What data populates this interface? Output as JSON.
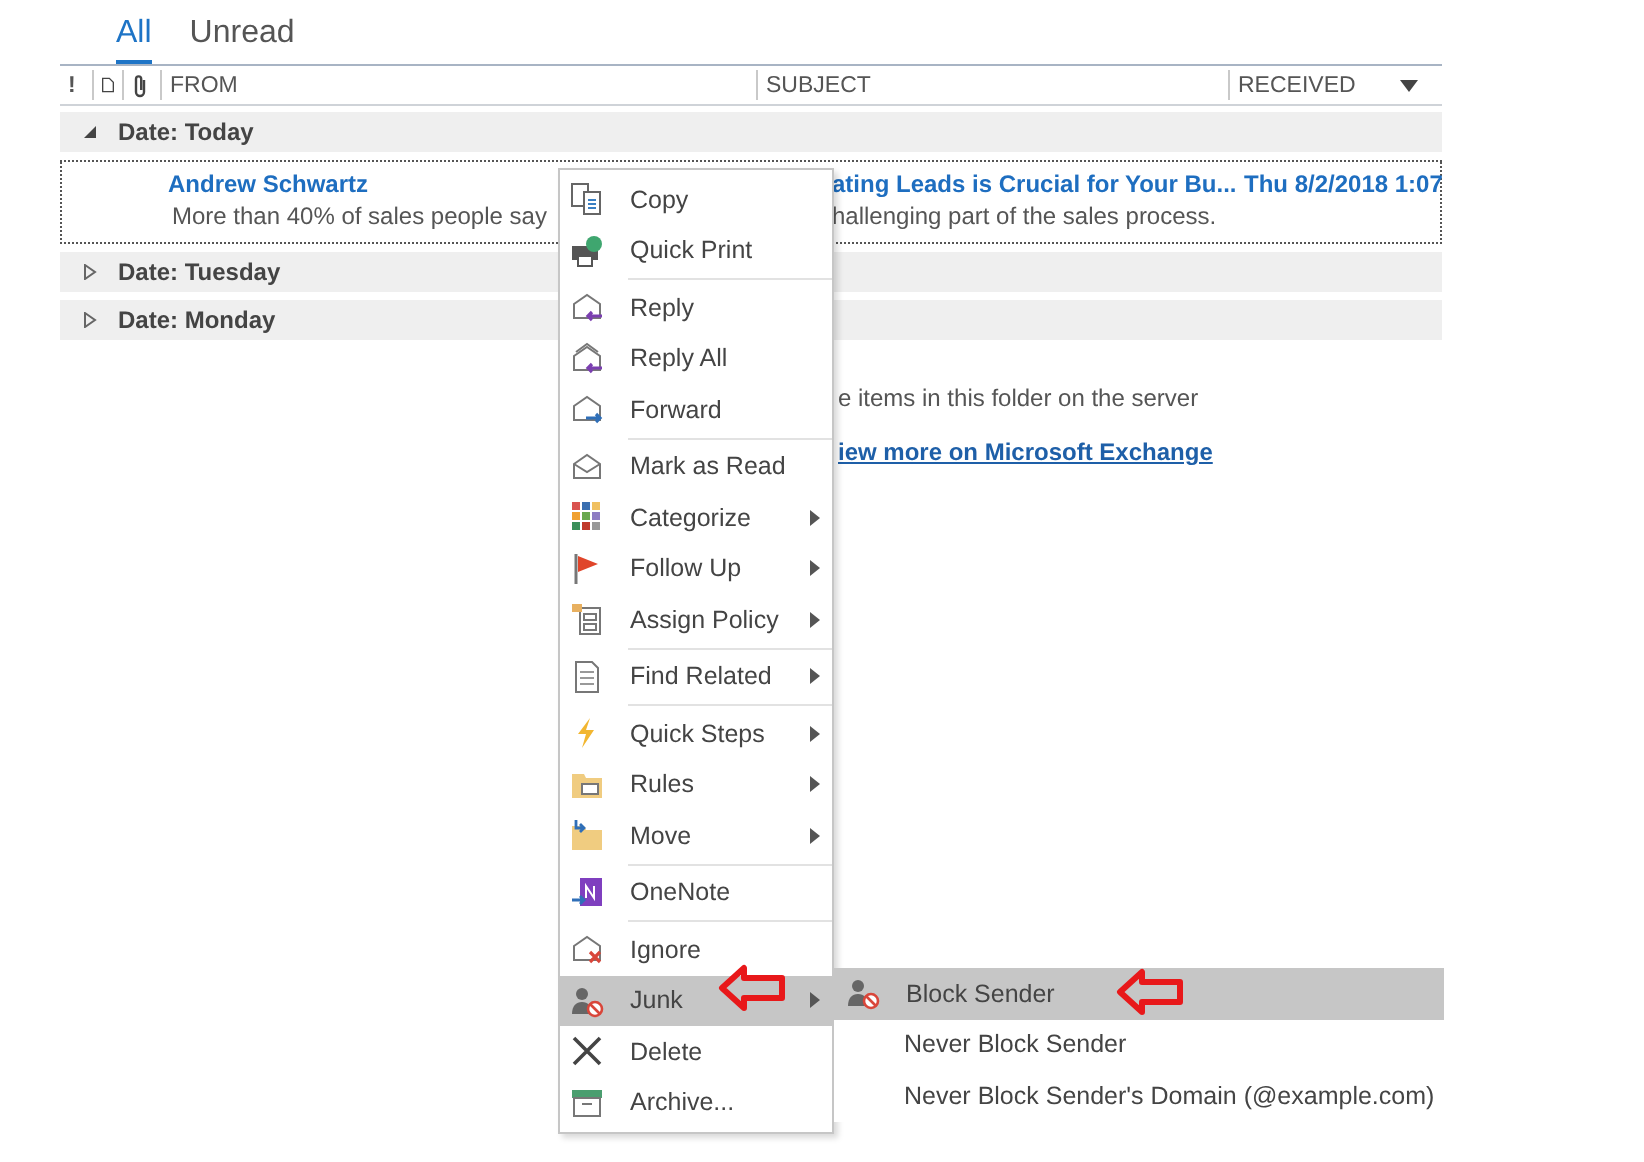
{
  "tabs": [
    {
      "label": "All",
      "selected": true
    },
    {
      "label": "Unread",
      "selected": false
    }
  ],
  "columns": [
    {
      "kind": "importance",
      "label": "!"
    },
    {
      "kind": "icon"
    },
    {
      "kind": "attachment"
    },
    {
      "kind": "text",
      "label": "FROM"
    },
    {
      "kind": "text",
      "label": "SUBJECT"
    },
    {
      "kind": "text",
      "label": "RECEIVED",
      "sorted": true
    }
  ],
  "groups": [
    {
      "label": "Date: Today",
      "expanded": true,
      "messages": [
        {
          "from": "Andrew Schwartz",
          "preview": "More than 40% of sales people say",
          "subject": "ating Leads is Crucial for Your Bu...",
          "preview_2": "hallenging part of the sales process.",
          "received": "Thu 8/2/2018 1:07",
          "unread": true
        }
      ]
    },
    {
      "label": "Date: Tuesday",
      "expanded": false
    },
    {
      "label": "Date: Monday",
      "expanded": false
    }
  ],
  "server_note": {
    "text": "e items in this folder on the server",
    "link": "iew more on Microsoft Exchange"
  },
  "context_menu": {
    "items": [
      {
        "label": "Copy",
        "submenu": false,
        "highlighted": false,
        "separator_before": false
      },
      {
        "label": "Quick Print",
        "submenu": false,
        "highlighted": false,
        "separator_before": false
      },
      {
        "label": "Reply",
        "submenu": false,
        "highlighted": false,
        "separator_before": true
      },
      {
        "label": "Reply All",
        "submenu": false,
        "highlighted": false,
        "separator_before": false
      },
      {
        "label": "Forward",
        "submenu": false,
        "highlighted": false,
        "separator_before": false
      },
      {
        "label": "Mark as Read",
        "submenu": false,
        "highlighted": false,
        "separator_before": true
      },
      {
        "label": "Categorize",
        "submenu": true,
        "highlighted": false,
        "separator_before": false
      },
      {
        "label": "Follow Up",
        "submenu": true,
        "highlighted": false,
        "separator_before": false
      },
      {
        "label": "Assign Policy",
        "submenu": true,
        "highlighted": false,
        "separator_before": false
      },
      {
        "label": "Find Related",
        "submenu": true,
        "highlighted": false,
        "separator_before": true
      },
      {
        "label": "Quick Steps",
        "submenu": true,
        "highlighted": false,
        "separator_before": true
      },
      {
        "label": "Rules",
        "submenu": true,
        "highlighted": false,
        "separator_before": false
      },
      {
        "label": "Move",
        "submenu": true,
        "highlighted": false,
        "separator_before": false
      },
      {
        "label": "OneNote",
        "submenu": false,
        "highlighted": false,
        "separator_before": true
      },
      {
        "label": "Ignore",
        "submenu": false,
        "highlighted": false,
        "separator_before": true
      },
      {
        "label": "Junk",
        "submenu": true,
        "highlighted": true,
        "separator_before": false
      },
      {
        "label": "Delete",
        "submenu": false,
        "highlighted": false,
        "separator_before": false
      },
      {
        "label": "Archive...",
        "submenu": false,
        "highlighted": false,
        "separator_before": false
      }
    ]
  },
  "submenu": {
    "items": [
      {
        "label": "Block Sender",
        "highlighted": true,
        "icon": true
      },
      {
        "label": "Never Block Sender",
        "highlighted": false,
        "icon": false
      },
      {
        "label": "Never Block Sender's Domain (@example.com)",
        "highlighted": false,
        "icon": false
      }
    ]
  }
}
